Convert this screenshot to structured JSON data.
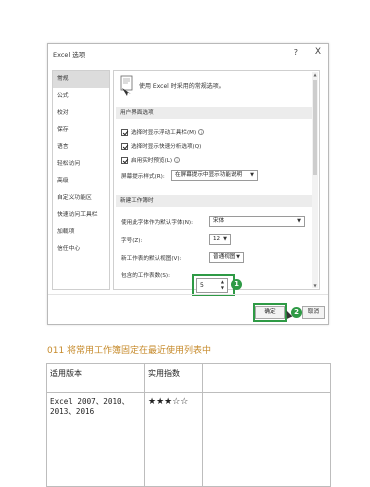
{
  "dialog": {
    "title": "Excel 选项",
    "help": "?",
    "close": "X",
    "sidebar": [
      {
        "label": "常规",
        "active": true
      },
      {
        "label": "公式",
        "active": false
      },
      {
        "label": "校对",
        "active": false
      },
      {
        "label": "保存",
        "active": false
      },
      {
        "label": "语言",
        "active": false
      },
      {
        "label": "轻松访问",
        "active": false
      },
      {
        "label": "高级",
        "active": false
      },
      {
        "label": "自定义功能区",
        "active": false
      },
      {
        "label": "快速访问工具栏",
        "active": false
      },
      {
        "label": "加载项",
        "active": false
      },
      {
        "label": "信任中心",
        "active": false
      }
    ],
    "intro": "使用 Excel 时采用的常规选项。",
    "ui_section": {
      "header": "用户界面选项",
      "checkboxes": [
        {
          "label": "选择时显示浮动工具栏(M)",
          "checked": true,
          "info": "ⓘ"
        },
        {
          "label": "选择时显示快速分析选项(Q)",
          "checked": true,
          "info": ""
        },
        {
          "label": "启用实时预览(L)",
          "checked": true,
          "info": "ⓘ"
        }
      ],
      "screentip_label": "屏幕提示样式(R):",
      "screentip_value": "在屏幕提示中显示功能说明"
    },
    "new_wb_section": {
      "header": "新建工作簿时",
      "font_label": "使用此字体作为默认字体(N):",
      "font_value": "宋体",
      "size_label": "字号(Z):",
      "size_value": "12",
      "view_label": "新工作表的默认视图(V):",
      "view_value": "普通视图",
      "sheets_label": "包含的工作表数(S):",
      "sheets_value": "5"
    },
    "ok_button": "确定",
    "cancel_button": "取消",
    "badge1": "1",
    "badge2": "2",
    "highlight_color": "#2e9a45"
  },
  "caption": "011 将常用工作簿固定在最近使用列表中",
  "table": {
    "headers": [
      "适用版本",
      "实用指数",
      ""
    ],
    "row": {
      "versions": "Excel 2007、2010、2013、2016",
      "rating": "★★★☆☆",
      "extra": ""
    }
  }
}
